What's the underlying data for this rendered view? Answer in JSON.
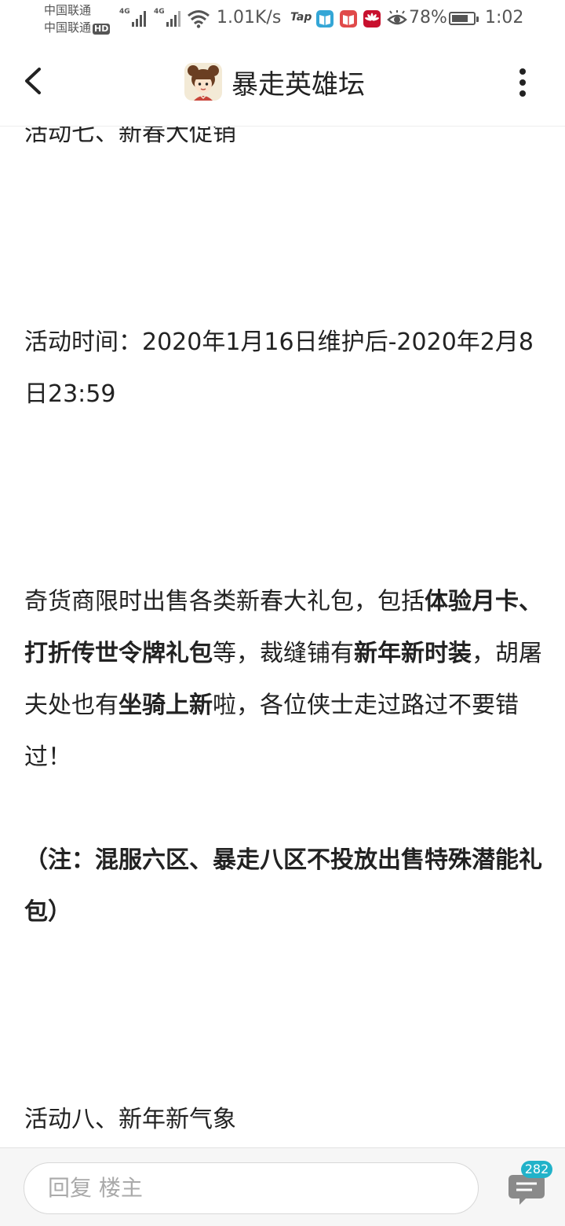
{
  "status_bar": {
    "carrier_1": "中国联通",
    "carrier_2": "中国联通",
    "hd": "HD",
    "signal_1_label": "4G",
    "signal_2_label": "4G",
    "net_speed": "1.01K/s",
    "tap_label": "Tap",
    "battery_percent": "78%",
    "battery_level": 0.78,
    "time": "1:02"
  },
  "header": {
    "title": "暴走英雄坛"
  },
  "post": {
    "p1": "活动七、新春大促销",
    "p2": "活动时间：2020年1月16日维护后-2020年2月8日23:59",
    "p3": {
      "t1": "奇货商限时出售各类新春大礼包，包括",
      "b1": "体验月卡、打折传世令牌礼包",
      "t2": "等，裁缝铺有",
      "b2": "新年新时装",
      "t3": "，胡屠夫处也有",
      "b3": "坐骑上新",
      "t4": "啦，各位侠士走过路过不要错过！"
    },
    "p4": "（注：混服六区、暴走八区不投放出售特殊潜能礼包）",
    "p5": "活动八、新年新气象"
  },
  "bottom_bar": {
    "reply_placeholder": "回复  楼主",
    "comment_count": "282"
  }
}
